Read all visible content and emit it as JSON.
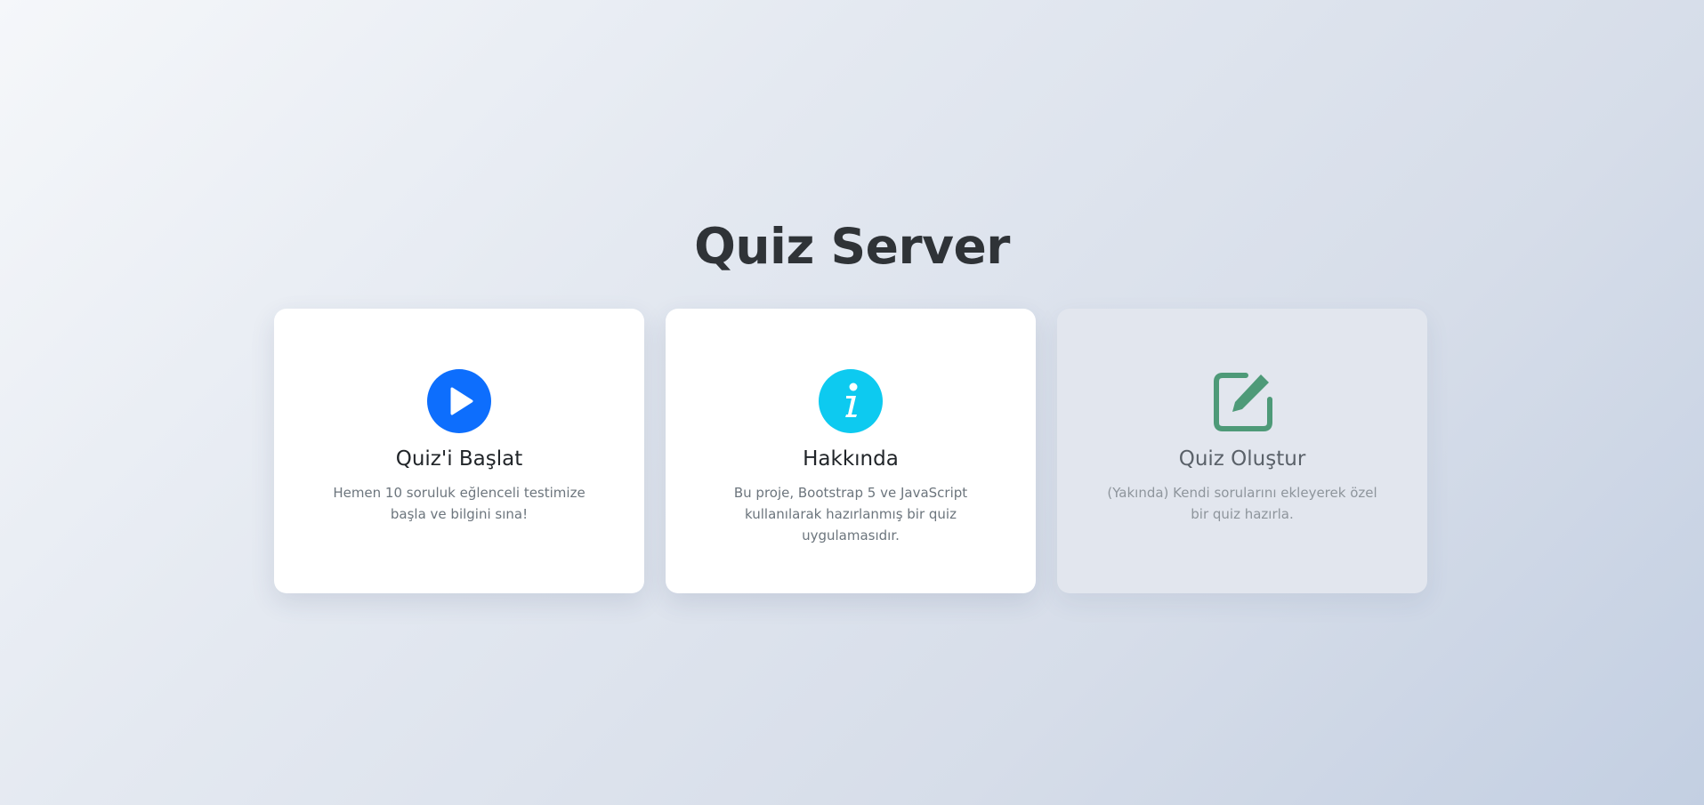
{
  "page": {
    "title": "Quiz Server"
  },
  "cards": [
    {
      "title": "Quiz'i Başlat",
      "description": "Hemen 10 soruluk eğlenceli testimize başla ve bilgini sına!",
      "icon": "play-icon",
      "icon_color": "#0d6efd"
    },
    {
      "title": "Hakkında",
      "description": "Bu proje, Bootstrap 5 ve JavaScript kullanılarak hazırlanmış bir quiz uygulamasıdır.",
      "icon": "info-icon",
      "icon_color": "#0dcaf0"
    },
    {
      "title": "Quiz Oluştur",
      "description": "(Yakında) Kendi sorularını ekleyerek özel bir quiz hazırla.",
      "icon": "edit-icon",
      "icon_color": "#4e9a78",
      "disabled": true
    }
  ]
}
